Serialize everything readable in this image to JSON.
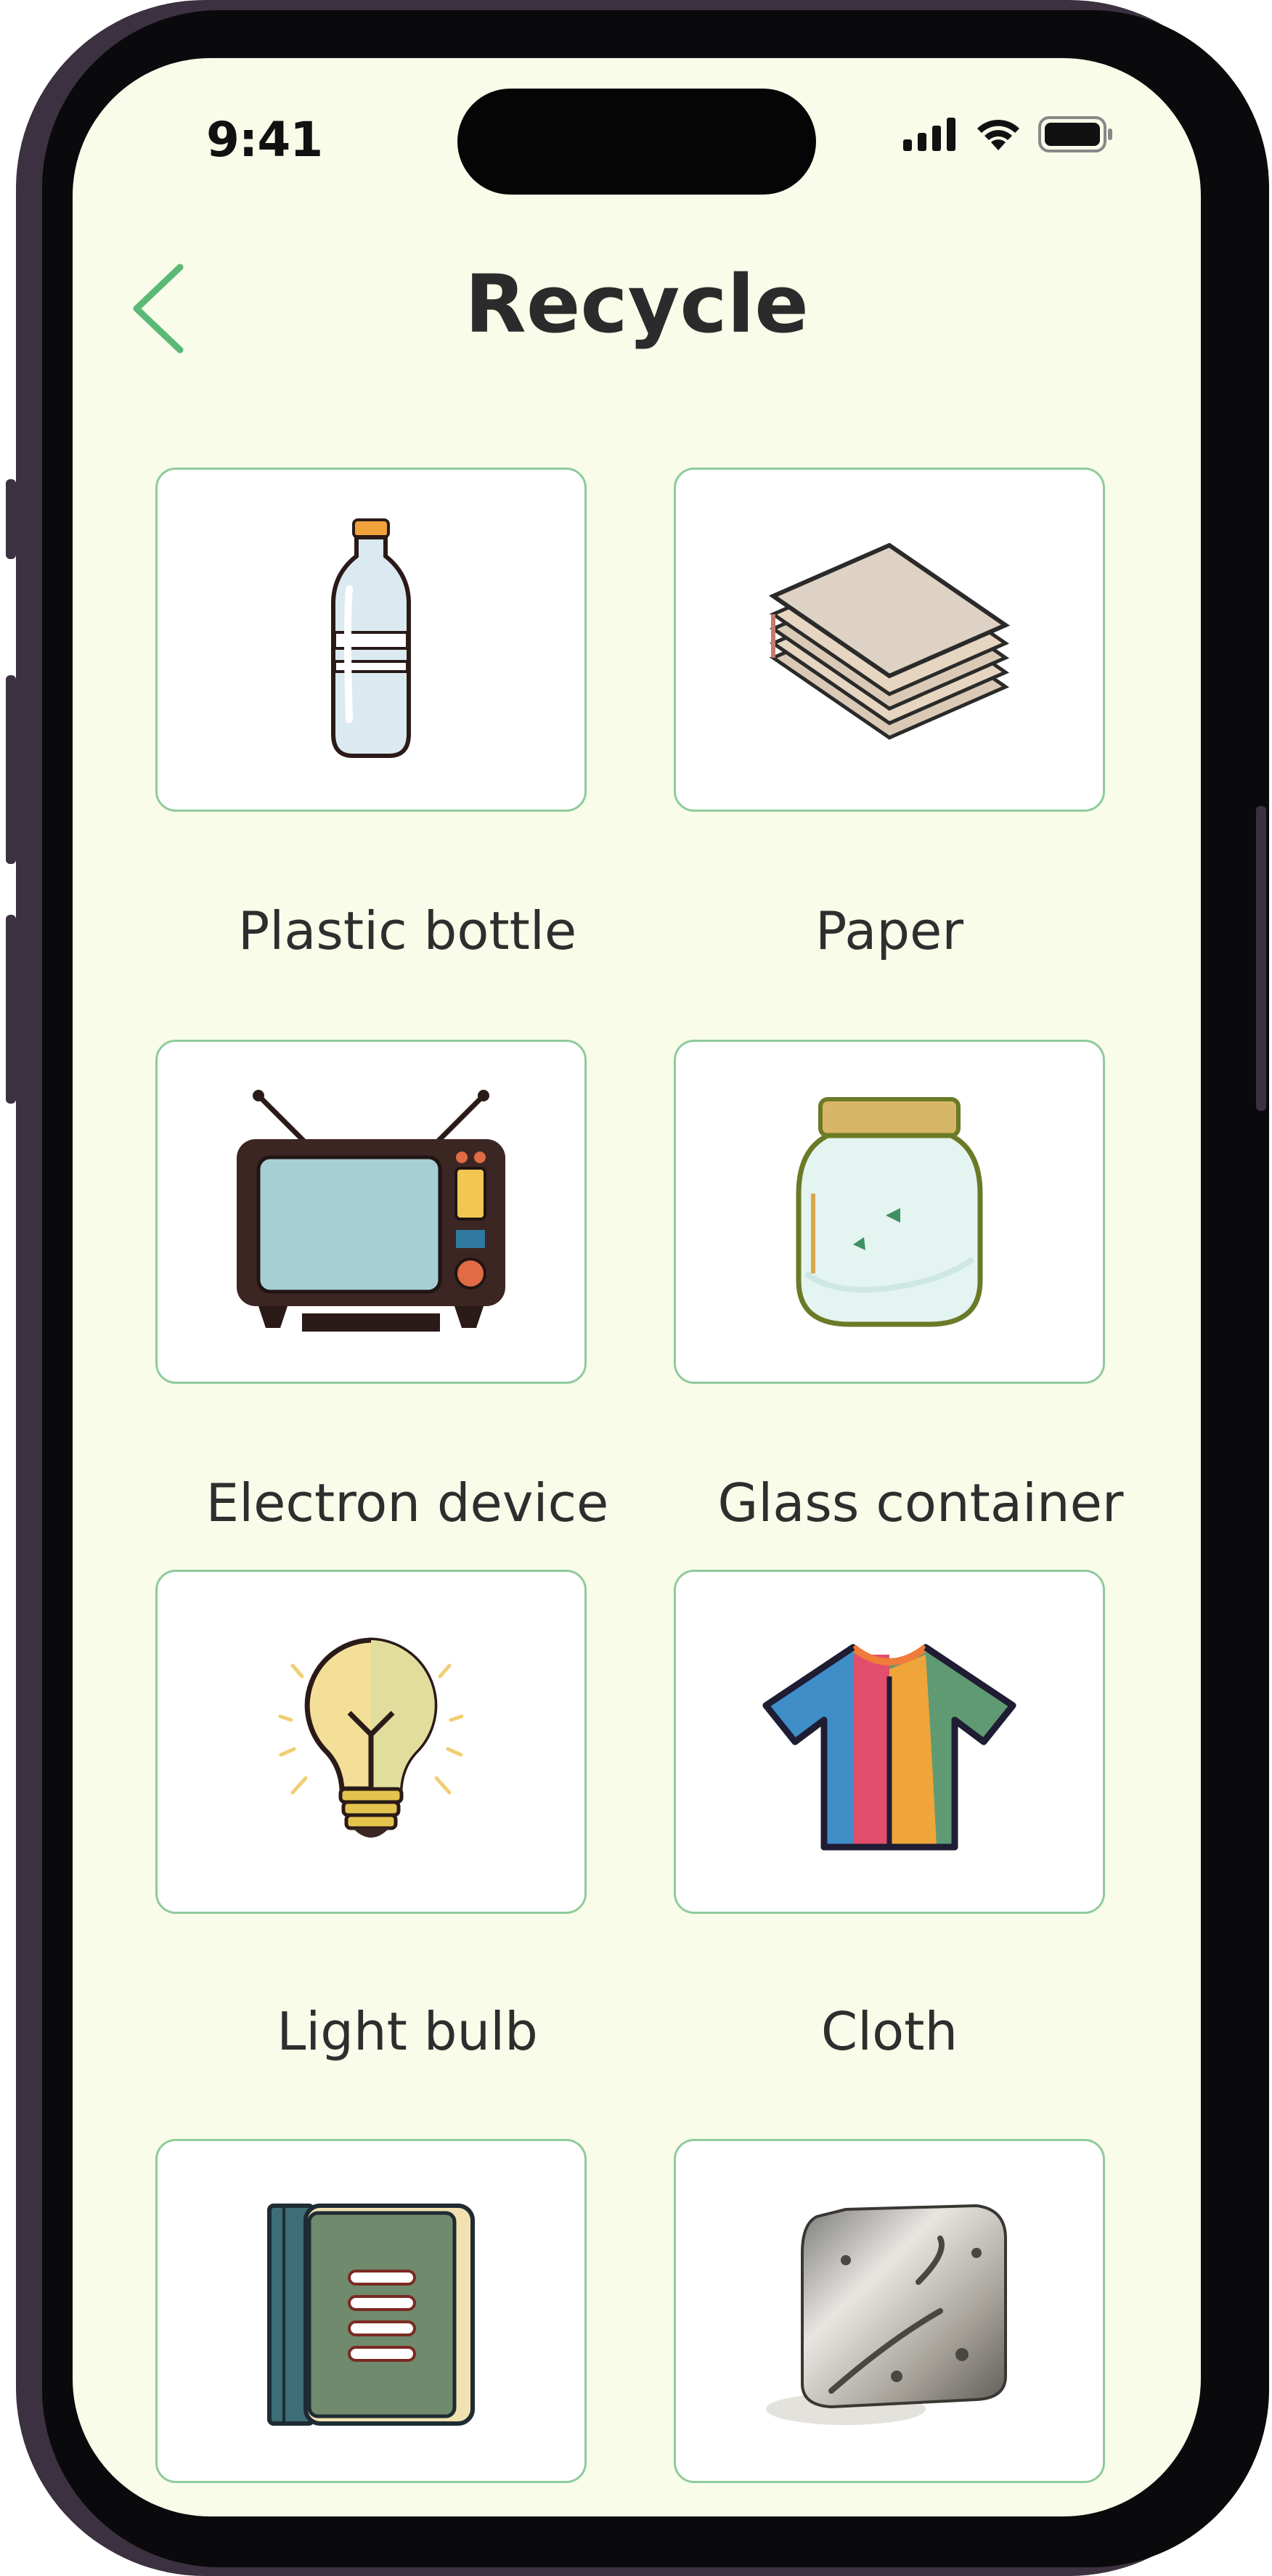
{
  "status_bar": {
    "time": "9:41"
  },
  "header": {
    "title": "Recycle",
    "back_icon": "chevron-left-icon"
  },
  "colors": {
    "accent": "#5cb876",
    "card_border": "#8fcb9b",
    "background": "#f8fce9"
  },
  "categories": [
    {
      "label": "Plastic bottle",
      "icon": "plastic-bottle-icon"
    },
    {
      "label": "Paper",
      "icon": "paper-stack-icon"
    },
    {
      "label": "Electron device",
      "icon": "tv-icon"
    },
    {
      "label": "Glass container",
      "icon": "glass-jar-icon"
    },
    {
      "label": "Light bulb",
      "icon": "light-bulb-icon"
    },
    {
      "label": "Cloth",
      "icon": "shirt-icon"
    },
    {
      "label": "",
      "icon": "book-icon"
    },
    {
      "label": "",
      "icon": "metal-plate-icon"
    }
  ]
}
